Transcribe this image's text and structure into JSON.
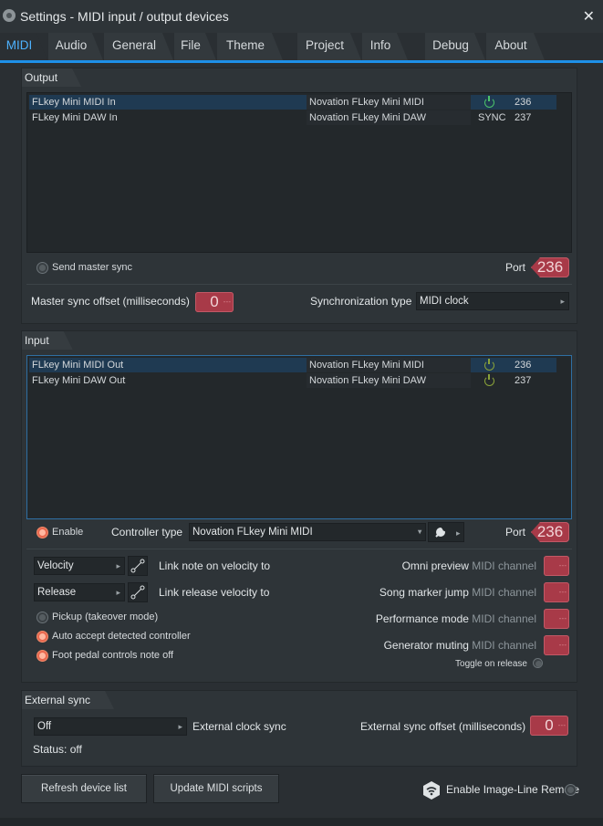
{
  "window": {
    "title": "Settings - MIDI input / output devices"
  },
  "tabs": [
    {
      "label": "MIDI",
      "active": true
    },
    {
      "label": "Audio"
    },
    {
      "label": "General"
    },
    {
      "label": "File"
    },
    {
      "label": "Theme"
    },
    {
      "label": "Project"
    },
    {
      "label": "Info"
    },
    {
      "label": "Debug"
    },
    {
      "label": "About"
    }
  ],
  "output": {
    "header": "Output",
    "devices": [
      {
        "name": "FLkey Mini MIDI In",
        "controller": "Novation FLkey Mini MIDI",
        "status": "",
        "port": "236"
      },
      {
        "name": "FLkey Mini DAW In",
        "controller": "Novation FLkey Mini DAW",
        "status": "SYNC",
        "port": "237"
      }
    ],
    "send_master_sync": "Send master sync",
    "port_label": "Port",
    "port_value": "236",
    "master_sync_offset_label": "Master sync offset (milliseconds)",
    "master_sync_offset_value": "0",
    "sync_type_label": "Synchronization type",
    "sync_type_value": "MIDI clock"
  },
  "input": {
    "header": "Input",
    "devices": [
      {
        "name": "FLkey Mini MIDI Out",
        "controller": "Novation FLkey Mini MIDI",
        "port": "236"
      },
      {
        "name": "FLkey Mini DAW Out",
        "controller": "Novation FLkey Mini DAW",
        "port": "237"
      }
    ],
    "enable_label": "Enable",
    "controller_type_label": "Controller type",
    "controller_type_value": "Novation FLkey Mini MIDI",
    "port_label": "Port",
    "port_value": "236",
    "velocity_combo": "Velocity",
    "link_note_label": "Link note on velocity to",
    "release_combo": "Release",
    "link_release_label": "Link release velocity to",
    "pickup_label": "Pickup (takeover mode)",
    "auto_accept_label": "Auto accept detected controller",
    "foot_pedal_label": "Foot pedal controls note off",
    "midi_channel_suffix": "MIDI channel",
    "omni_preview": "Omni preview",
    "song_marker_jump": "Song marker jump",
    "performance_mode": "Performance mode",
    "generator_muting": "Generator muting",
    "toggle_on_release": "Toggle on release"
  },
  "external_sync": {
    "header": "External sync",
    "clock_value": "Off",
    "clock_label": "External clock sync",
    "offset_label": "External sync offset (milliseconds)",
    "offset_value": "0",
    "status": "Status: off"
  },
  "footer": {
    "refresh": "Refresh device list",
    "update_scripts": "Update MIDI scripts",
    "remote_label": "Enable Image-Line Remote"
  },
  "colors": {
    "accent": "#1e90e8",
    "knob": "#a83a48",
    "radio_on": "#e8684f",
    "power": "#4cc36a"
  }
}
